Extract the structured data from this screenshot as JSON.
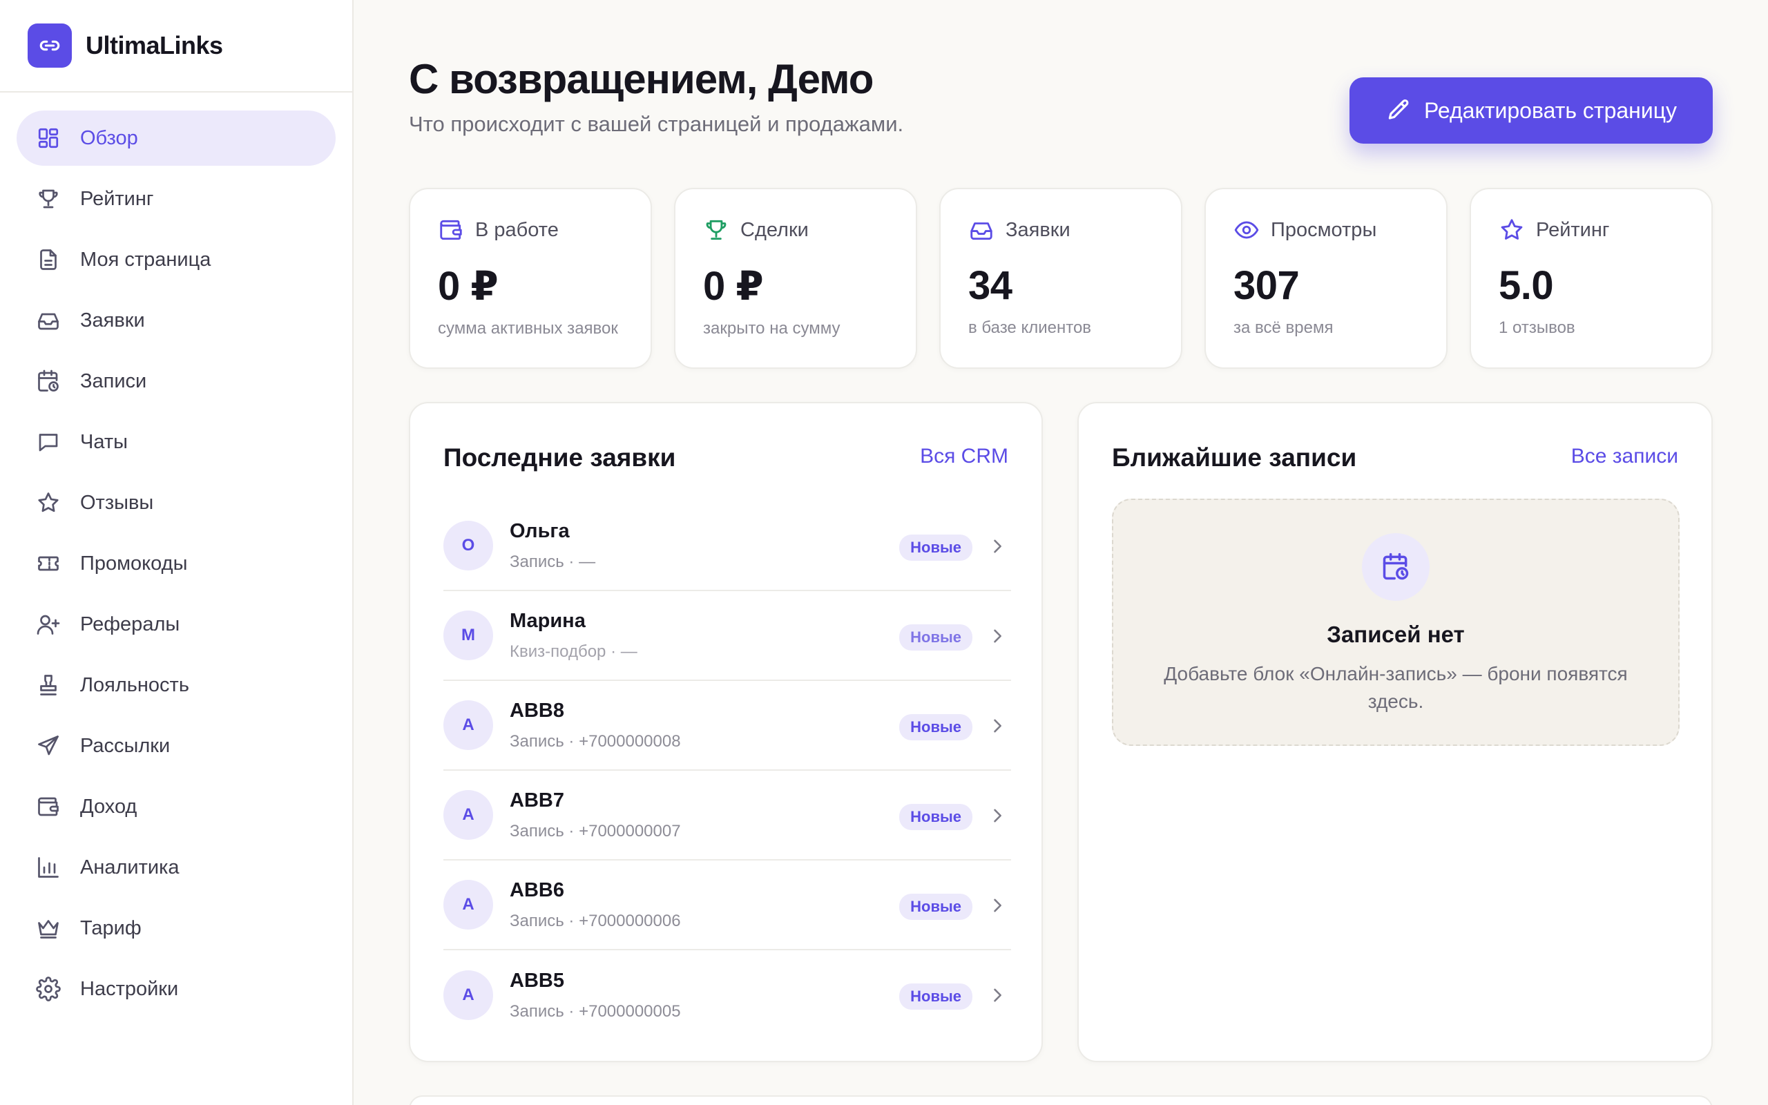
{
  "brand": {
    "name": "UltimaLinks"
  },
  "sidebar": {
    "items": [
      {
        "label": "Обзор",
        "icon": "dashboard-icon"
      },
      {
        "label": "Рейтинг",
        "icon": "trophy-icon"
      },
      {
        "label": "Моя страница",
        "icon": "document-icon"
      },
      {
        "label": "Заявки",
        "icon": "inbox-icon"
      },
      {
        "label": "Записи",
        "icon": "calendar-clock-icon"
      },
      {
        "label": "Чаты",
        "icon": "chat-icon"
      },
      {
        "label": "Отзывы",
        "icon": "star-icon"
      },
      {
        "label": "Промокоды",
        "icon": "ticket-icon"
      },
      {
        "label": "Рефералы",
        "icon": "user-plus-icon"
      },
      {
        "label": "Лояльность",
        "icon": "stamp-icon"
      },
      {
        "label": "Рассылки",
        "icon": "send-icon"
      },
      {
        "label": "Доход",
        "icon": "wallet-icon"
      },
      {
        "label": "Аналитика",
        "icon": "bar-chart-icon"
      },
      {
        "label": "Тариф",
        "icon": "crown-icon"
      },
      {
        "label": "Настройки",
        "icon": "gear-icon"
      }
    ]
  },
  "header": {
    "title": "С возвращением, Демо",
    "subtitle": "Что происходит с вашей страницей и продажами.",
    "edit_button": "Редактировать страницу"
  },
  "stats": [
    {
      "label": "В работе",
      "value": "0 ₽",
      "note": "сумма активных заявок",
      "icon": "wallet-icon"
    },
    {
      "label": "Сделки",
      "value": "0 ₽",
      "note": "закрыто на сумму",
      "icon": "trophy-icon"
    },
    {
      "label": "Заявки",
      "value": "34",
      "note": "в базе клиентов",
      "icon": "inbox-icon"
    },
    {
      "label": "Просмотры",
      "value": "307",
      "note": "за всё время",
      "icon": "eye-icon"
    },
    {
      "label": "Рейтинг",
      "value": "5.0",
      "note": "1 отзывов",
      "icon": "star-icon"
    }
  ],
  "leads": {
    "title": "Последние заявки",
    "link": "Вся CRM",
    "rows": [
      {
        "initial": "О",
        "name": "Ольга",
        "sub": "Запись · —",
        "badge": "Новые"
      },
      {
        "initial": "М",
        "name": "Марина",
        "sub": "Квиз-подбор · —",
        "badge": "Новые"
      },
      {
        "initial": "А",
        "name": "АВВ8",
        "sub": "Запись · +7000000008",
        "badge": "Новые"
      },
      {
        "initial": "А",
        "name": "АВВ7",
        "sub": "Запись · +7000000007",
        "badge": "Новые"
      },
      {
        "initial": "А",
        "name": "АВВ6",
        "sub": "Запись · +7000000006",
        "badge": "Новые"
      },
      {
        "initial": "А",
        "name": "АВВ5",
        "sub": "Запись · +7000000005",
        "badge": "Новые"
      }
    ]
  },
  "bookings": {
    "title": "Ближайшие записи",
    "link": "Все записи",
    "empty_title": "Записей нет",
    "empty_text": "Добавьте блок «Онлайн-запись» — брони появятся здесь."
  },
  "colors": {
    "accent": "#5b4ce6",
    "accent_soft": "#ece9fb",
    "success": "#1f9e63",
    "background": "#faf9f6"
  }
}
